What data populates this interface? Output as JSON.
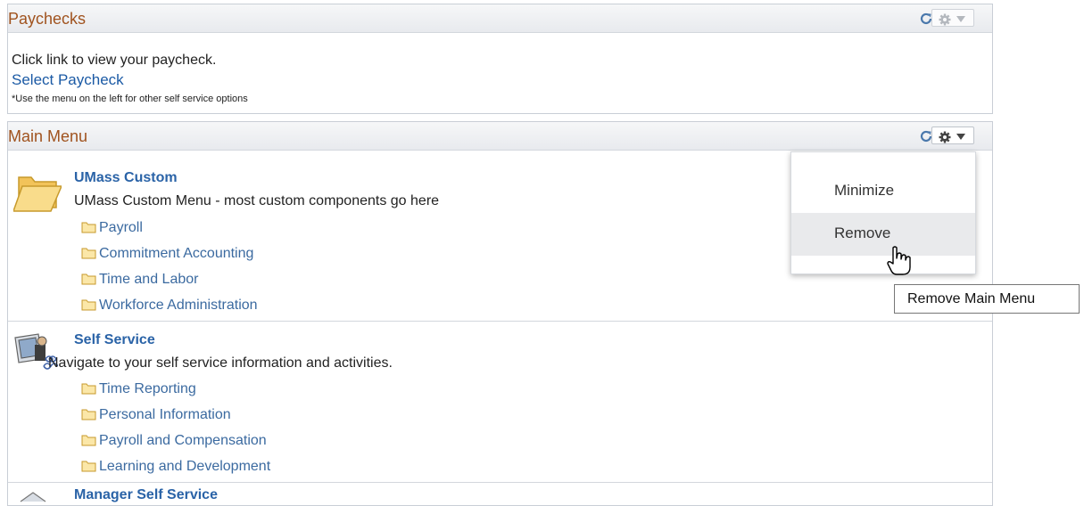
{
  "paychecks": {
    "title": "Paychecks",
    "instruction": "Click link to view your paycheck.",
    "link": "Select Paycheck",
    "note": "*Use the menu on the left for other self service options"
  },
  "main_menu": {
    "title": "Main Menu",
    "categories": [
      {
        "title": "UMass Custom",
        "description": "UMass Custom Menu - most custom components go here",
        "icon": "folder-icon",
        "items": [
          "Payroll",
          "Commitment Accounting",
          "Time and Labor",
          "Workforce Administration"
        ]
      },
      {
        "title": "Self Service",
        "description": "Navigate to your self service information and activities.",
        "icon": "self-service-icon",
        "items": [
          "Time Reporting",
          "Personal Information",
          "Payroll and Compensation",
          "Learning and Development"
        ]
      },
      {
        "title": "Manager Self Service",
        "icon": "manager-self-service-icon"
      }
    ]
  },
  "options_menu": {
    "items": [
      "Minimize",
      "Remove"
    ],
    "hovered": "Remove"
  },
  "tooltip": "Remove Main Menu",
  "colors": {
    "header_title": "#a0531f",
    "link": "#1b5aa5",
    "category_title": "#2a63a7",
    "folder_fill": "#f6d27a",
    "folder_stroke": "#c79a2c"
  }
}
